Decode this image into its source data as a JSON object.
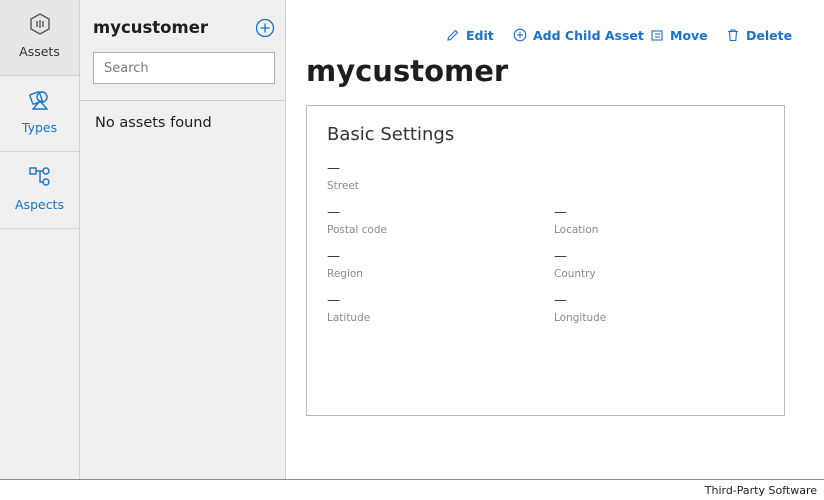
{
  "nav": {
    "items": [
      {
        "label": "Assets",
        "icon": "assets-icon",
        "active": true
      },
      {
        "label": "Types",
        "icon": "types-icon",
        "active": false
      },
      {
        "label": "Aspects",
        "icon": "aspects-icon",
        "active": false
      }
    ]
  },
  "tree": {
    "title": "mycustomer",
    "search_placeholder": "Search",
    "empty_message": "No assets found"
  },
  "toolbar": {
    "edit": "Edit",
    "add_child": "Add Child Asset",
    "move": "Move",
    "delete": "Delete"
  },
  "main": {
    "title": "mycustomer",
    "card": {
      "title": "Basic Settings",
      "fields": {
        "street": {
          "label": "Street",
          "value": "—"
        },
        "postal_code": {
          "label": "Postal code",
          "value": "—"
        },
        "location": {
          "label": "Location",
          "value": "—"
        },
        "region": {
          "label": "Region",
          "value": "—"
        },
        "country": {
          "label": "Country",
          "value": "—"
        },
        "latitude": {
          "label": "Latitude",
          "value": "—"
        },
        "longitude": {
          "label": "Longitude",
          "value": "—"
        }
      }
    }
  },
  "footer": {
    "text": "Third-Party Software"
  },
  "colors": {
    "accent": "#1a73c8",
    "panel": "#f0f0f0"
  }
}
